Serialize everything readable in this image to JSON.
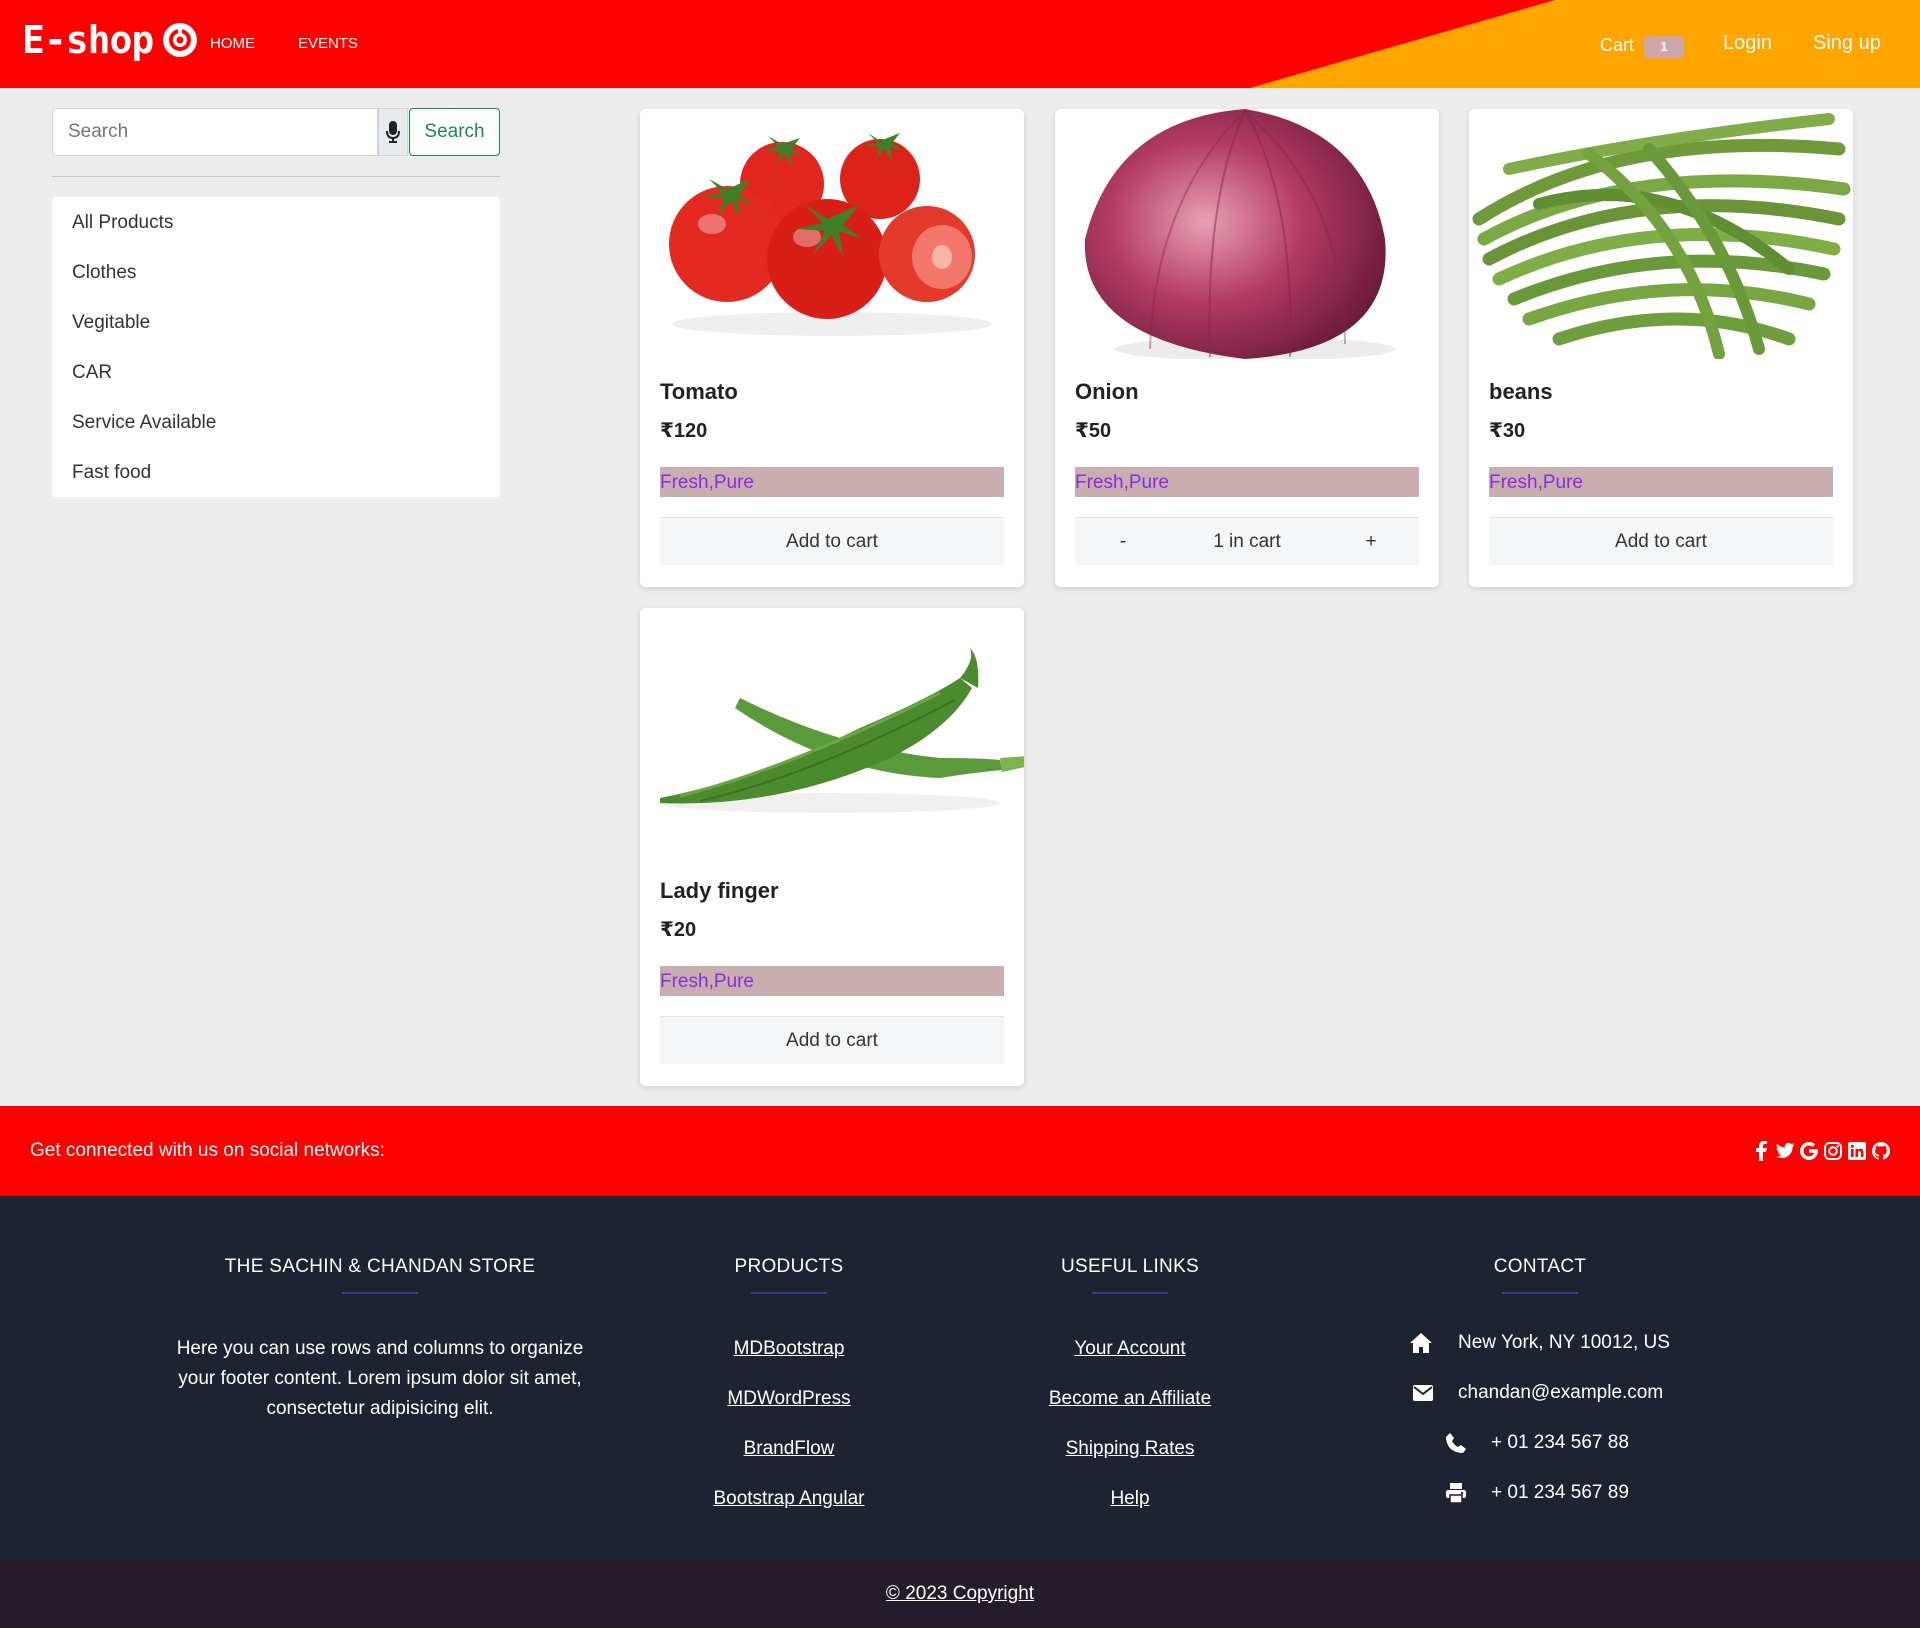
{
  "header": {
    "brand": "E-shop",
    "brand_icon": "target-logo-icon",
    "nav": [
      "HOME",
      "EVENTS"
    ],
    "cart_label": "Cart",
    "cart_count": "1",
    "login": "Login",
    "signup": "Sing up",
    "colors": {
      "primary": "#ff0000",
      "accent": "#ffa500"
    }
  },
  "sidebar": {
    "search_placeholder": "Search",
    "search_button": "Search",
    "categories": [
      "All Products",
      "Clothes",
      "Vegitable",
      "CAR",
      "Service Available",
      "Fast food"
    ]
  },
  "products": [
    {
      "name": "Tomato",
      "price": "₹120",
      "tags": "Fresh,Pure",
      "action": "Add to cart",
      "in_cart": false
    },
    {
      "name": "Onion",
      "price": "₹50",
      "tags": "Fresh,Pure",
      "action": "1 in cart",
      "in_cart": true,
      "minus": "-",
      "plus": "+"
    },
    {
      "name": "beans",
      "price": "₹30",
      "tags": "Fresh,Pure",
      "action": "Add to cart",
      "in_cart": false
    },
    {
      "name": "Lady finger",
      "price": "₹20",
      "tags": "Fresh,Pure",
      "action": "Add to cart",
      "in_cart": false
    }
  ],
  "social": {
    "text": "Get connected with us on social networks:",
    "icons": [
      "facebook-icon",
      "twitter-icon",
      "google-icon",
      "instagram-icon",
      "linkedin-icon",
      "github-icon"
    ]
  },
  "footer": {
    "store": {
      "title": "THE SACHIN & CHANDAN STORE",
      "text": "Here you can use rows and columns to organize your footer content. Lorem ipsum dolor sit amet, consectetur adipisicing elit."
    },
    "products": {
      "title": "PRODUCTS",
      "links": [
        "MDBootstrap",
        "MDWordPress",
        "BrandFlow",
        "Bootstrap Angular"
      ]
    },
    "useful": {
      "title": "USEFUL LINKS",
      "links": [
        "Your Account",
        "Become an Affiliate",
        "Shipping Rates",
        "Help"
      ]
    },
    "contact": {
      "title": "CONTACT",
      "address": "New York, NY 10012, US",
      "email": "chandan@example.com",
      "phone": "+ 01 234 567 88",
      "fax": "+ 01 234 567 89"
    }
  },
  "copyright": "© 2023 Copyright"
}
